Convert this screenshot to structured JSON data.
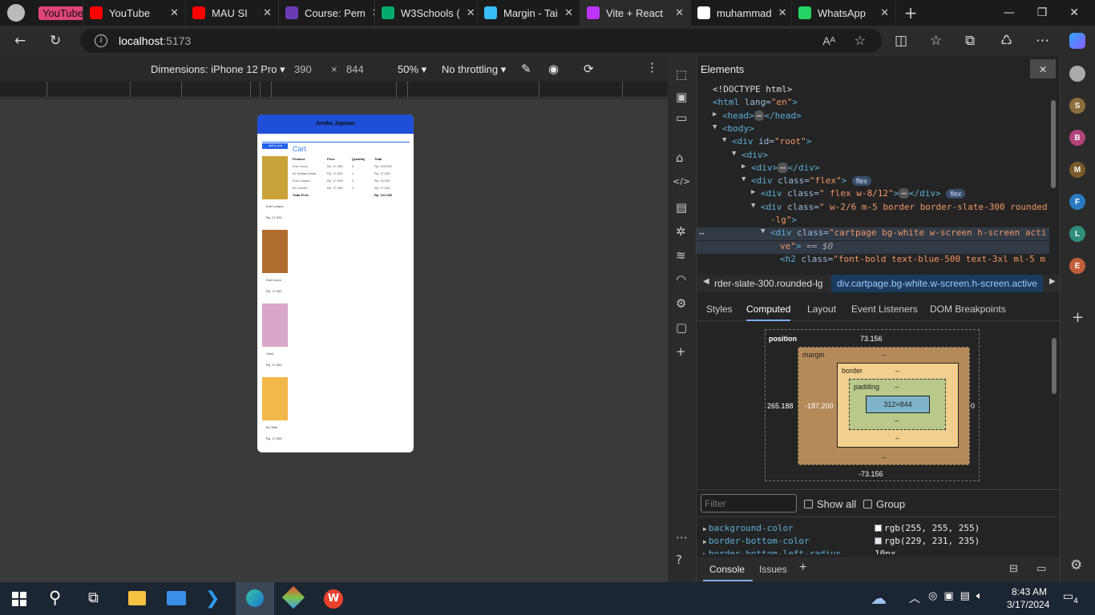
{
  "tabs": [
    {
      "label": "YouTube",
      "color": "#e0447a",
      "badge": true
    },
    {
      "label": "YouTube",
      "color": "#ff0000"
    },
    {
      "label": "MAU SI",
      "color": "#ff0000"
    },
    {
      "label": "Course: Pem",
      "color": "#6a3ab2"
    },
    {
      "label": "W3Schools (",
      "color": "#04aa6d"
    },
    {
      "label": "Margin - Tai",
      "color": "#38bdf8"
    },
    {
      "label": "Vite + React",
      "color": "#bd34fe"
    },
    {
      "label": "muhammad",
      "color": "#ffffff"
    },
    {
      "label": "WhatsApp",
      "color": "#25d366"
    }
  ],
  "address": {
    "host": "localhost",
    "port": ":5173"
  },
  "devbar": {
    "dimensions": "Dimensions: iPhone 12 Pro",
    "width": "390",
    "x": "×",
    "height": "844",
    "zoom": "50%",
    "throttle": "No throttling"
  },
  "app": {
    "header": "Aneka Jajanan",
    "products": [
      {
        "name": "Kue Lumpur",
        "price": "Rp. 17.000"
      },
      {
        "name": "Kue Cucur",
        "price": "Rp. 17.000"
      },
      {
        "name": "Cenil",
        "price": "Rp. 17.000"
      },
      {
        "name": "Es Teler",
        "price": "Rp. 17.000"
      }
    ],
    "cart_title": "Cart",
    "cart_headers": [
      "Product",
      "Price",
      "Quantity",
      "Total"
    ],
    "cart_rows": [
      [
        "Kue Cucur",
        "Rp. 17.000",
        "9",
        "Rp. 153.000"
      ],
      [
        "Es Kelapa Muda",
        "Rp. 17.000",
        "1",
        "Rp. 17.000"
      ],
      [
        "Kue Lumpur",
        "Rp. 17.000",
        "2",
        "Rp. 34.000"
      ],
      [
        "Es Cendol",
        "Rp. 17.000",
        "1",
        "Rp. 17.000"
      ]
    ],
    "total_label": "Total Price",
    "total_value": "Rp. 221.000",
    "button": "Add to cart"
  },
  "devtools": {
    "title": "Elements",
    "lines": [
      {
        "indent": 0,
        "html": "<!DOCTYPE html>"
      },
      {
        "indent": 0,
        "tag": "html",
        "attrs": " lang=",
        "val": "\"en\"",
        "close": ">"
      },
      {
        "indent": 1,
        "arrow": "▶",
        "tag": "head",
        "text": "</head>"
      },
      {
        "indent": 1,
        "arrow": "▼",
        "tag": "body",
        "close": ">"
      },
      {
        "indent": 2,
        "arrow": "▼",
        "tag": "div",
        "attrs": " id=",
        "val": "\"root\"",
        "close": ">"
      },
      {
        "indent": 3,
        "arrow": "▼",
        "tag": "div",
        "close": ">"
      },
      {
        "indent": 4,
        "arrow": "▶",
        "tag": "div",
        "text": "</div>"
      },
      {
        "indent": 4,
        "arrow": "▼",
        "tag": "div",
        "attrs": " class=",
        "val": "\"flex\"",
        "close": ">",
        "pill": "flex"
      },
      {
        "indent": 5,
        "arrow": "▶",
        "tag": "div",
        "attrs": " class=",
        "val": "\" flex w-8/12\"",
        "text": "</div>",
        "pill": "flex"
      },
      {
        "indent": 5,
        "arrow": "▼",
        "tag": "div",
        "attrs": " class=",
        "val": "\" w-2/6 m-5 border border-slate-300 rounded"
      },
      {
        "indent": 5,
        "cont": true,
        "val": "-lg\"",
        "close": ">"
      },
      {
        "indent": 6,
        "arrow": "▼",
        "tag": "div",
        "attrs": " class=",
        "val": "\"cartpage bg-white w-screen h-screen acti",
        "selected": true
      },
      {
        "indent": 6,
        "cont": true,
        "val": "ve\"",
        "close": ">",
        "extra": " == $0",
        "selected": true
      },
      {
        "indent": 7,
        "tag": "h2",
        "attrs": " class=",
        "val": "\"font-bold text-blue-500 text-3xl ml-5 m"
      }
    ],
    "crumb_left": "rder-slate-300.rounded-lg",
    "crumb_right": "div.cartpage.bg-white.w-screen.h-screen.active",
    "subtabs": [
      "Styles",
      "Computed",
      "Layout",
      "Event Listeners",
      "DOM Breakpoints"
    ],
    "box": {
      "position": "position",
      "top": "73.156",
      "left": "265.188",
      "right": "0",
      "bottom": "-73.156",
      "margin": "margin",
      "margin_left": "-187.200",
      "border": "border",
      "padding": "padding",
      "content": "312×844",
      "dash": "–"
    },
    "filter_placeholder": "Filter",
    "show_all": "Show all",
    "group": "Group",
    "props": [
      {
        "name": "background-color",
        "value": "rgb(255, 255, 255)",
        "swatch": "#ffffff"
      },
      {
        "name": "border-bottom-color",
        "value": "rgb(229, 231, 235)",
        "swatch": "#e5e7eb"
      },
      {
        "name": "border-bottom-left-radius",
        "value": "10px"
      }
    ],
    "drawer": [
      "Console",
      "Issues"
    ]
  },
  "right_avatars": [
    {
      "letter": "S",
      "color": "#8a6d3b"
    },
    {
      "letter": "B",
      "color": "#b3447a"
    },
    {
      "letter": "M",
      "color": "#7a5a2a"
    },
    {
      "letter": "F",
      "color": "#2b7ac0"
    },
    {
      "letter": "L",
      "color": "#2f8f7a"
    },
    {
      "letter": "E",
      "color": "#c0603a"
    }
  ],
  "clock": {
    "time": "8:43 AM",
    "date": "3/17/2024",
    "notif": "4"
  }
}
